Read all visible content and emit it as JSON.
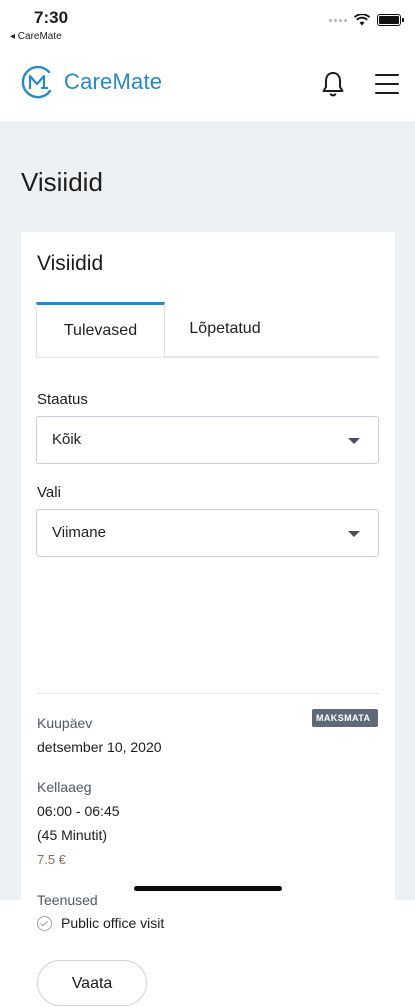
{
  "status_bar": {
    "time": "7:30",
    "back_app": "◂ CareMate"
  },
  "header": {
    "app_name": "CareMate",
    "brand_color": "#2a88c6",
    "icons": [
      "notification-bell-icon",
      "hamburger-menu-icon"
    ]
  },
  "page": {
    "title": "Visiidid"
  },
  "card": {
    "title": "Visiidid",
    "tabs": [
      {
        "label": "Tulevased",
        "active": true
      },
      {
        "label": "Lõpetatud",
        "active": false
      }
    ],
    "filters": {
      "status_label": "Staatus",
      "status_value": "Kõik",
      "sort_label": "Vali",
      "sort_value": "Viimane"
    },
    "visit": {
      "badge": "MAKSMATA",
      "date_label": "Kuupäev",
      "date_value": "detsember 10, 2020",
      "time_label": "Kellaaeg",
      "time_value": "06:00 - 06:45",
      "duration": "(45 Minutit)",
      "price": "7.5 €",
      "services_label": "Teenused",
      "service": "Public office visit",
      "view_button": "Vaata"
    }
  }
}
